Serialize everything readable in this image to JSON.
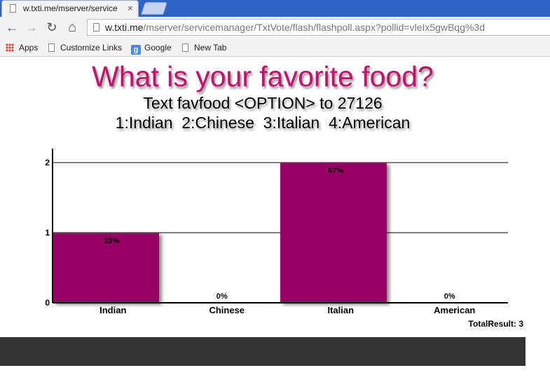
{
  "browser": {
    "tab_title": "w.txti.me/mserver/service",
    "tab_close": "×",
    "url_host": "w.txti.me",
    "url_rest": "/mserver/servicemanager/TxtVote/flash/flashpoll.aspx?pollid=vleIx5gwBqg%3d",
    "nav": {
      "back": "←",
      "forward": "→",
      "reload": "↻",
      "home": "⌂"
    },
    "bookmarks": [
      {
        "label": "Apps",
        "icon": "apps-grid-icon"
      },
      {
        "label": "Customize Links",
        "icon": "page-icon"
      },
      {
        "label": "Google",
        "icon": "google-icon"
      },
      {
        "label": "New Tab",
        "icon": "page-icon"
      }
    ]
  },
  "poll": {
    "title": "What is your favorite food?",
    "instruction": "Text favfood <OPTION> to 27126",
    "options_line": "1:Indian  2:Chinese  3:Italian  4:American",
    "total_label": "TotalResult: 3",
    "bar_color": "#990066"
  },
  "chart_data": {
    "type": "bar",
    "categories": [
      "Indian",
      "Chinese",
      "Italian",
      "American"
    ],
    "values": [
      1,
      0,
      2,
      0
    ],
    "data_labels": [
      "33%",
      "0%",
      "67%",
      "0%"
    ],
    "yticks": [
      "0",
      "1",
      "2"
    ],
    "ylim": [
      0,
      2.2
    ],
    "grid": true
  }
}
